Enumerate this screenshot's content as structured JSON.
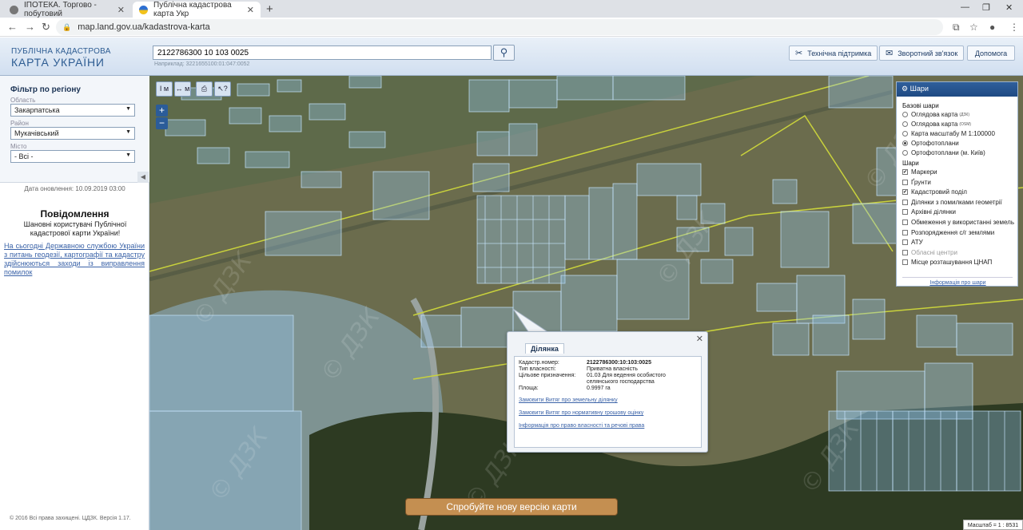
{
  "browser": {
    "tabs": [
      {
        "label": "ІПОТЕКА. Торгово - побутовий",
        "active": false
      },
      {
        "label": "Публічна кадастрова карта Укр",
        "active": true
      }
    ],
    "url": "map.land.gov.ua/kadastrova-karta"
  },
  "header": {
    "logo_line1": "ПУБЛІЧНА КАДАСТРОВА",
    "logo_line2": "КАРТА УКРАЇНИ",
    "search_value": "2122786300 10 103 0025",
    "search_hint": "Наприклад: 3221655100:01:047:0052",
    "buttons": {
      "support": "Технічна підтримка",
      "feedback": "Зворотний зв'язок",
      "help": "Допомога"
    }
  },
  "filter": {
    "title": "Фільтр по регіону",
    "oblast_label": "Область",
    "oblast_value": "Закарпатська",
    "rayon_label": "Район",
    "rayon_value": "Мукачівський",
    "city_label": "Місто",
    "city_value": "- Всі -"
  },
  "sidebar": {
    "updated": "Дата оновлення: 10.09.2019 03:00",
    "notice_title": "Повідомлення",
    "notice_text": "Шановні користувачі Публічної кадастрової карти України!",
    "notice_link": "На сьогодні Державною службою України з питань геодезії, картографії та кадастру здійснюються заходи із виправлення помилок",
    "copyright": "© 2016 Всі права захищені. ЦДЗК. Версія 1.17."
  },
  "map": {
    "tools": [
      "I м",
      "↔ м",
      "⎙",
      "↖?"
    ],
    "zoom_in": "+",
    "zoom_out": "−",
    "watermark": "© ДЗК",
    "new_version_button": "Спробуйте нову версію карти",
    "scale": "Масштаб = 1 : 8531"
  },
  "layers": {
    "title": "Шари",
    "base_title": "Базові шари",
    "base": [
      {
        "label": "Оглядова карта",
        "sup": "(ДЗК)",
        "checked": false
      },
      {
        "label": "Оглядова карта",
        "sup": "(OSM)",
        "checked": false
      },
      {
        "label": "Карта масштабу М 1:100000",
        "sup": "",
        "checked": false
      },
      {
        "label": "Ортофотоплани",
        "sup": "",
        "checked": true
      },
      {
        "label": "Ортофотоплани (м. Київ)",
        "sup": "",
        "checked": false
      }
    ],
    "overlay_title": "Шари",
    "overlay": [
      {
        "label": "Маркери",
        "checked": true
      },
      {
        "label": "Ґрунти",
        "checked": false
      },
      {
        "label": "Кадастровий поділ",
        "checked": true
      },
      {
        "label": "Ділянки з помилками геометрії",
        "checked": false
      },
      {
        "label": "Архівні ділянки",
        "checked": false
      },
      {
        "label": "Обмеження у використанні земель",
        "checked": false
      },
      {
        "label": "Розпорядження с/г землями",
        "checked": false
      },
      {
        "label": "АТУ",
        "checked": false
      },
      {
        "label": "Обласні центри",
        "checked": false
      },
      {
        "label": "Місце розташування ЦНАП",
        "checked": false
      }
    ],
    "info_link": "Інформація про шари"
  },
  "popup": {
    "tab": "Ділянка",
    "rows": [
      {
        "key": "Кадастр.номер:",
        "value": "2122786300:10:103:0025"
      },
      {
        "key": "Тип власності:",
        "value": "Приватна власність"
      },
      {
        "key": "Цільове призначення:",
        "value": "01.03 Для ведення особистого селянського господарства"
      },
      {
        "key": "Площа:",
        "value": "0.9997 га"
      }
    ],
    "links": [
      "Замовити Витяг про земельну ділянку",
      "Замовити Витяг про нормативну грошову оцінку",
      "Інформація про право власності та речові права"
    ]
  }
}
